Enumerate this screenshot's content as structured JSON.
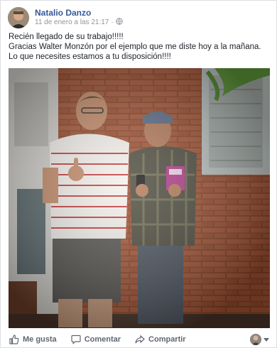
{
  "post": {
    "author": "Natalio Danzo",
    "timestamp": "11 de enero a las 21:17",
    "separator": "·",
    "audience_icon": "globe-icon",
    "text_lines": [
      "Recién llegado de su trabajo!!!!!",
      "Gracias Walter Monzón por el ejemplo que me diste hoy a la mañana.",
      "Lo que necesites estamos a tu disposición!!!!"
    ]
  },
  "actions": {
    "like_label": "Me gusta",
    "comment_label": "Comentar",
    "share_label": "Compartir"
  },
  "icons": {
    "like": "thumbs-up-icon",
    "comment": "speech-bubble-icon",
    "share": "share-arrow-icon",
    "dropdown": "caret-down-icon"
  },
  "colors": {
    "author_link": "#385898",
    "meta_text": "#90949c",
    "action_text": "#606770"
  }
}
